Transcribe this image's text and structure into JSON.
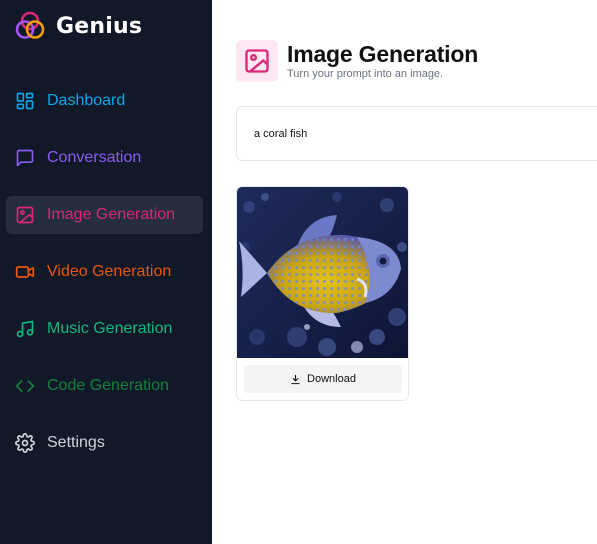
{
  "app": {
    "name": "Genius"
  },
  "sidebar": {
    "items": [
      {
        "label": "Dashboard",
        "icon": "dashboard-icon",
        "color": "#0ea5e9"
      },
      {
        "label": "Conversation",
        "icon": "message-square-icon",
        "color": "#8b5cf6"
      },
      {
        "label": "Image Generation",
        "icon": "image-icon",
        "color": "#db2777",
        "active": true
      },
      {
        "label": "Video Generation",
        "icon": "video-icon",
        "color": "#ea580c"
      },
      {
        "label": "Music Generation",
        "icon": "music-icon",
        "color": "#10b981"
      },
      {
        "label": "Code Generation",
        "icon": "code-icon",
        "color": "#15803d"
      },
      {
        "label": "Settings",
        "icon": "settings-icon",
        "color": "#d1d5db"
      }
    ]
  },
  "header": {
    "title": "Image Generation",
    "subtitle": "Turn your prompt into an image.",
    "icon": "image-icon",
    "icon_color": "#db2777",
    "icon_bg": "#fce7f3"
  },
  "prompt": {
    "value": "a coral fish"
  },
  "results": [
    {
      "image": "generated coral fish image",
      "download_label": "Download"
    }
  ]
}
